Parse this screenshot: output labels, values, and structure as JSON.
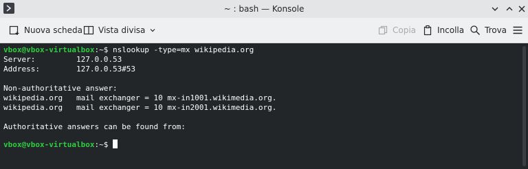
{
  "window": {
    "title": "~ : bash — Konsole"
  },
  "toolbar": {
    "new_tab_label": "Nuova scheda",
    "split_view_label": "Vista divisa",
    "copy_label": "Copia",
    "paste_label": "Incolla",
    "find_label": "Trova"
  },
  "terminal": {
    "prompt_user": "vbox@vbox-virtualbox",
    "prompt_suffix": ":~$ ",
    "command": "nslookup -type=mx wikipedia.org",
    "output": [
      "Server:         127.0.0.53",
      "Address:        127.0.0.53#53",
      "",
      "Non-authoritative answer:",
      "wikipedia.org   mail exchanger = 10 mx-in1001.wikimedia.org.",
      "wikipedia.org   mail exchanger = 10 mx-in2001.wikimedia.org.",
      "",
      "Authoritative answers can be found from:"
    ]
  },
  "colors": {
    "terminal_bg": "#232629",
    "prompt": "#2ecc40",
    "text": "#fcfcfc"
  },
  "icons": [
    "konsole-app-icon",
    "chevron-down-icon",
    "chevron-up-icon",
    "close-icon",
    "new-tab-icon",
    "split-view-icon",
    "copy-icon",
    "paste-icon",
    "search-icon",
    "hamburger-menu-icon"
  ]
}
